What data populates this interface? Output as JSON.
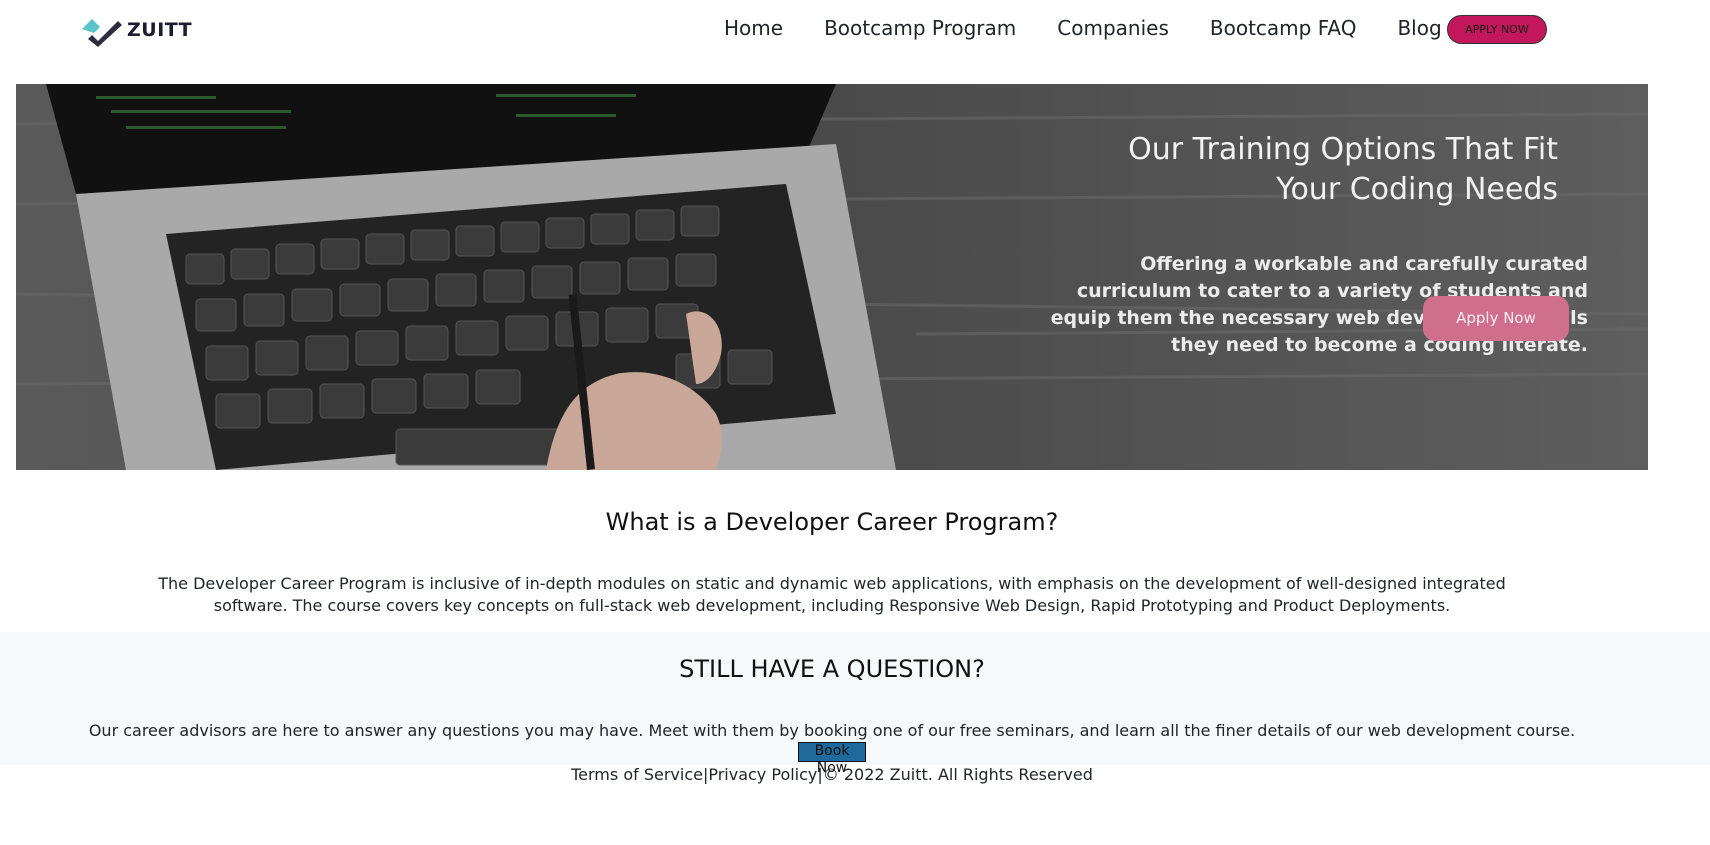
{
  "brand": {
    "name": "ZUITT"
  },
  "nav": {
    "links": [
      "Home",
      "Bootcamp Program",
      "Companies",
      "Bootcamp FAQ",
      "Blog"
    ],
    "apply_label": "APPLY NOW"
  },
  "hero": {
    "title_line1": "Our Training Options That Fit",
    "title_line2": "Your Coding Needs",
    "text": "Offering a workable and carefully curated curriculum to cater to a variety of students and equip them the necessary web development skills they need to become a coding literate.",
    "button_label": "Apply Now"
  },
  "program": {
    "title": "What is a Developer Career Program?",
    "text": "The Developer Career Program is inclusive of in-depth modules on static and dynamic web applications, with emphasis on the development of well-designed integrated software. The course covers key concepts on full-stack web development, including Responsive Web Design, Rapid Prototyping and Product Deployments."
  },
  "question": {
    "title": "STILL HAVE A QUESTION?",
    "text": "Our career advisors are here to answer any questions you may have. Meet with them by booking one of our free seminars, and learn all the finer details of our web development course.",
    "button_label": "Book Now"
  },
  "footer": {
    "terms": "Terms of Service",
    "separator": "|",
    "privacy": "Privacy Policy",
    "copyright": "© 2022 Zuitt. All Rights Reserved"
  },
  "colors": {
    "accent": "#c2185b",
    "hero_button": "#d06e8d",
    "book_button": "#1f6a9a",
    "band": "#f6f9fa"
  }
}
